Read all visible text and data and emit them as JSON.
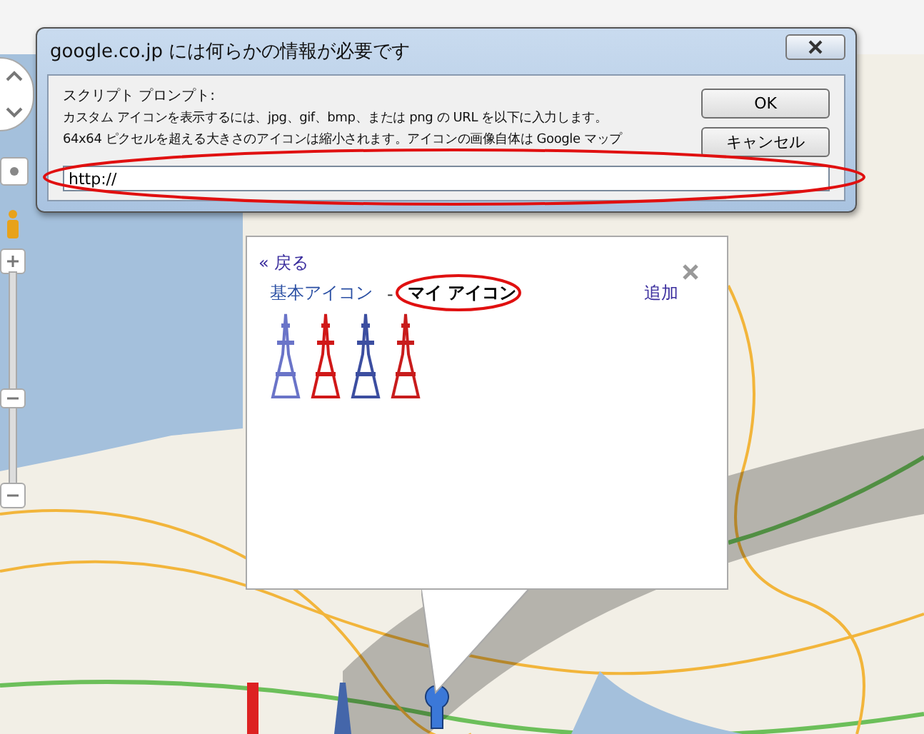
{
  "dialog": {
    "title": "google.co.jp には何らかの情報が必要です",
    "heading": "スクリプト プロンプト:",
    "message": [
      "カスタム アイコンを表示するには、jpg、gif、bmp、または png の URL を以下に入力します。",
      "64x64 ピクセルを超える大きさのアイコンは縮小されます。アイコンの画像自体は Google マップ"
    ],
    "input_value": "http://",
    "buttons": [
      "OK",
      "キャンセル"
    ]
  },
  "zoom": {
    "level": 0.4
  },
  "info_window": {
    "back_link": "« 戻る",
    "tabs": [
      {
        "label": "基本アイコン",
        "selected": false
      },
      {
        "label": "マイ アイコン",
        "selected": true
      }
    ],
    "separator": "-",
    "add_link": "追加"
  }
}
